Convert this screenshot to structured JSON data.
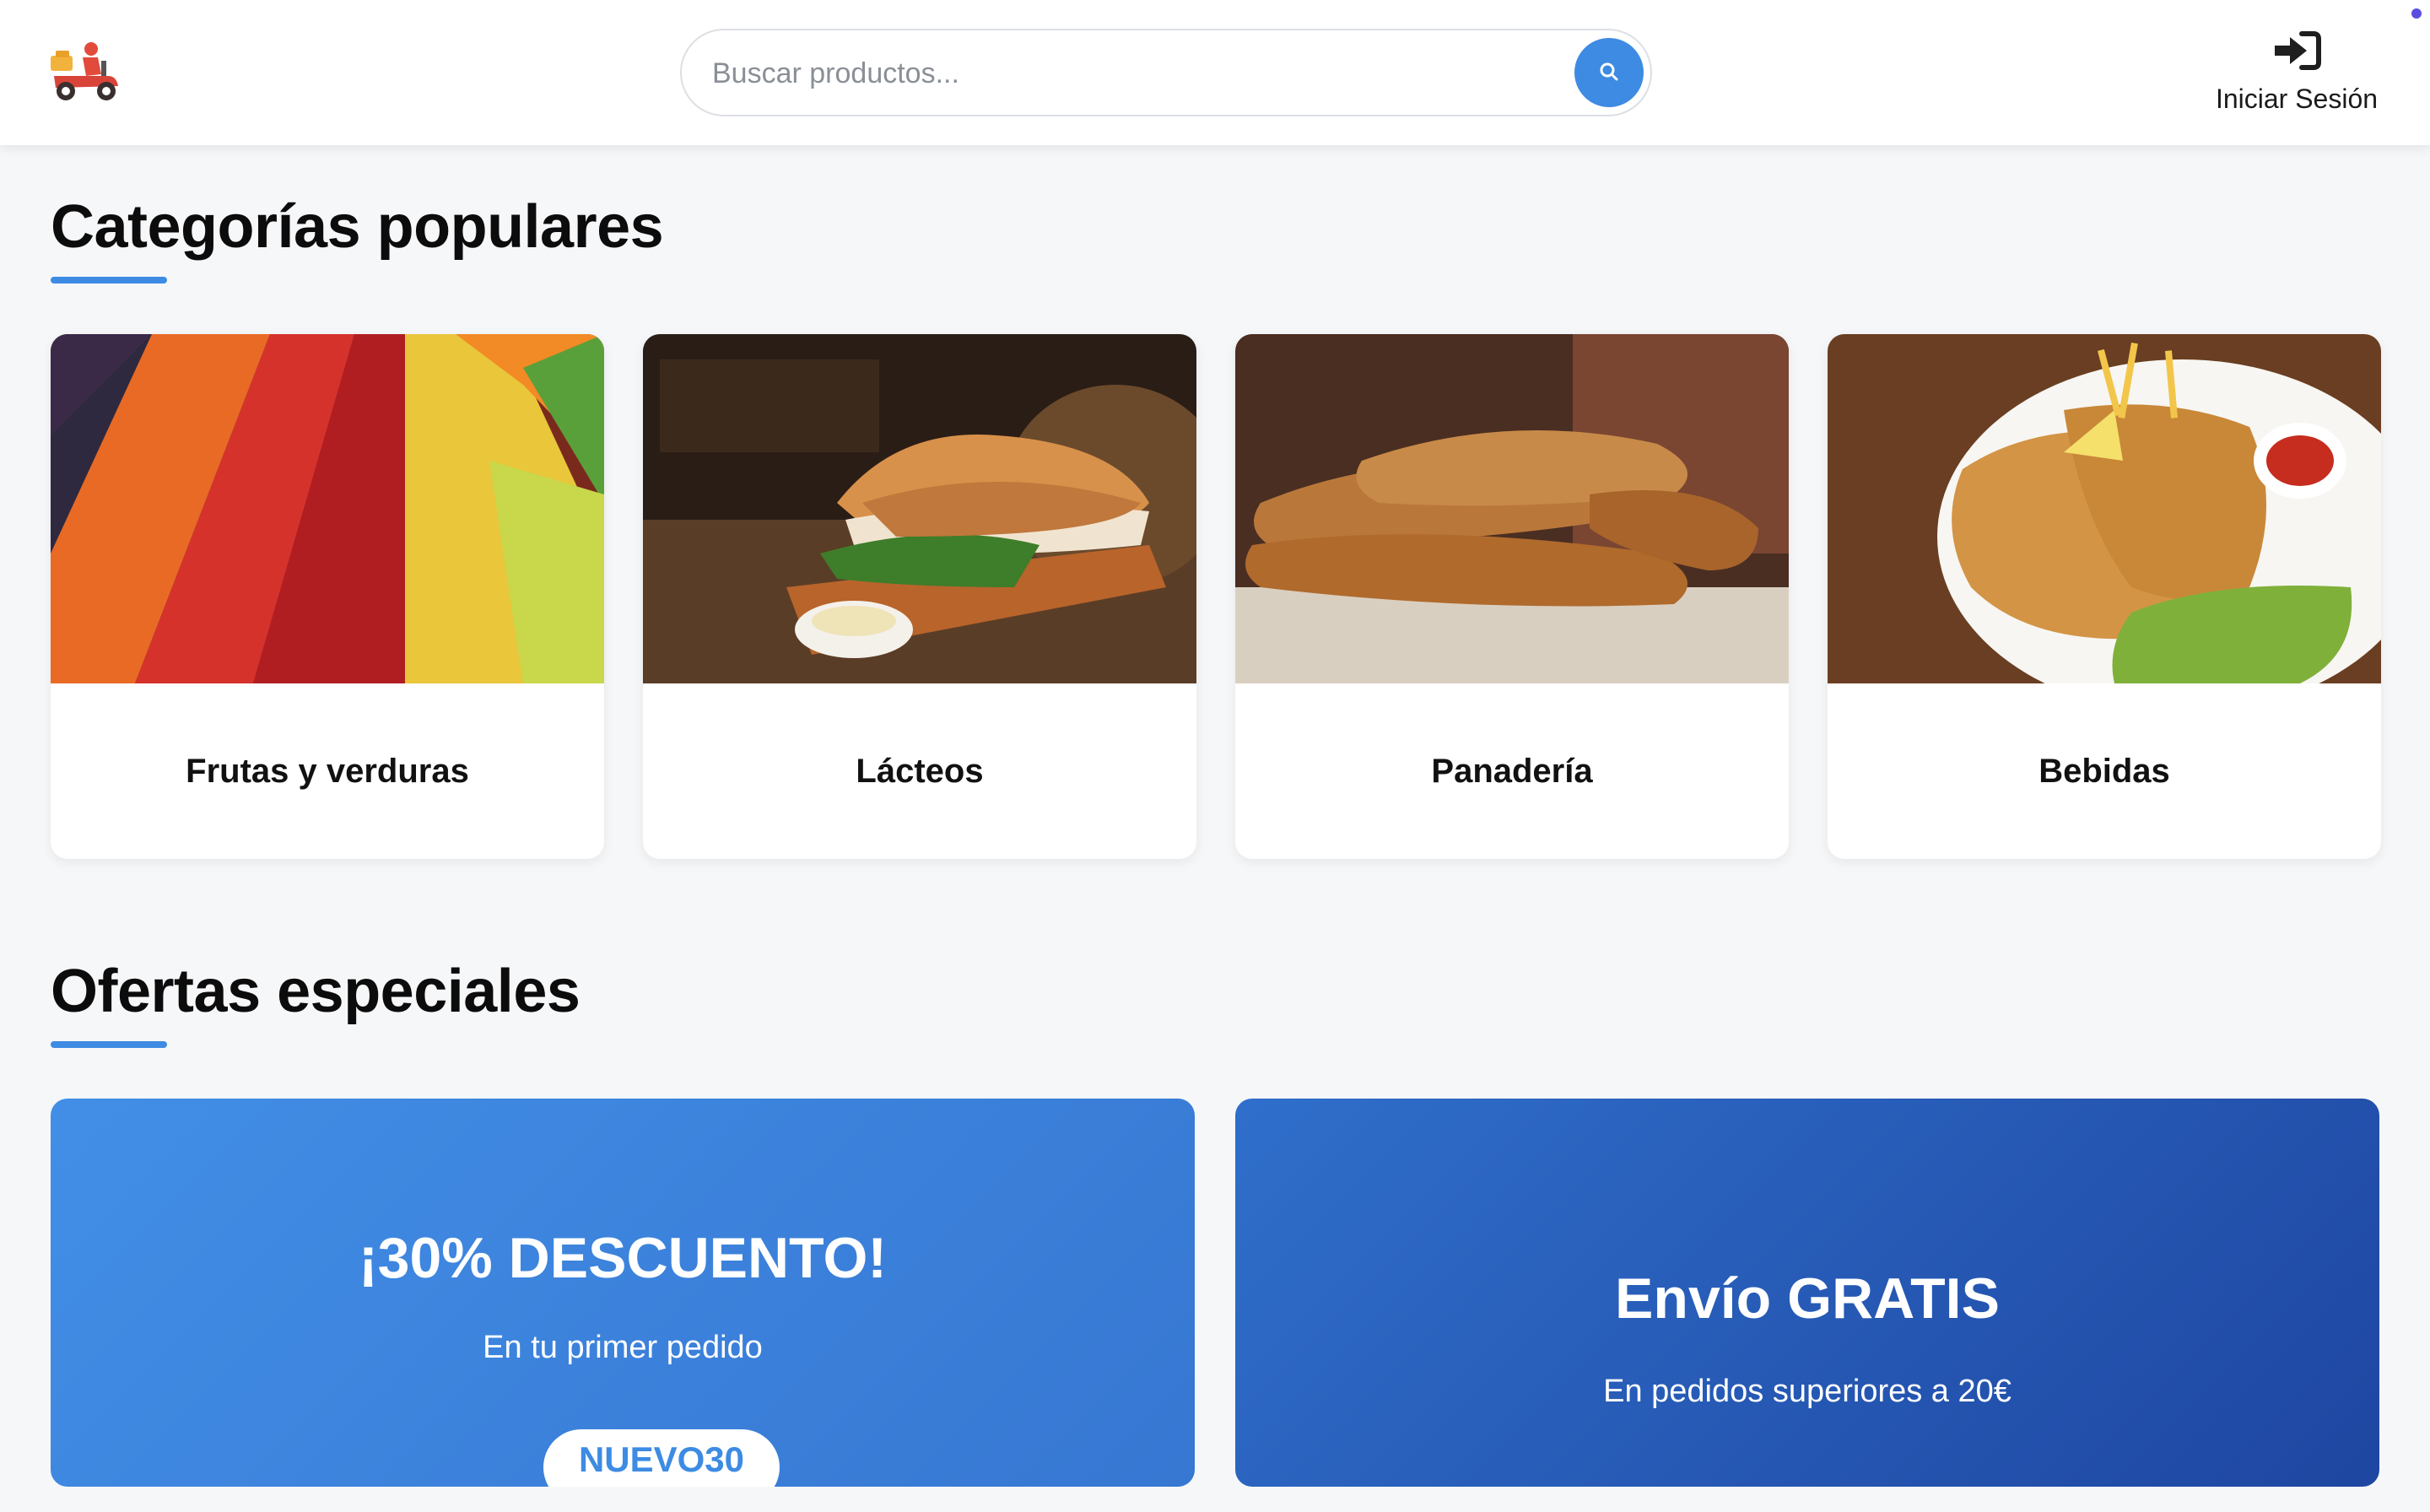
{
  "header": {
    "logo_icon": "delivery-scooter-icon",
    "search": {
      "placeholder": "Buscar productos...",
      "value": "",
      "icon": "search-icon"
    },
    "login": {
      "label": "Iniciar Sesión",
      "icon": "sign-in-icon"
    }
  },
  "categories_section": {
    "title": "Categorías populares",
    "items": [
      {
        "label": "Frutas y verduras",
        "image": "fruits-vegetables-photo"
      },
      {
        "label": "Lácteos",
        "image": "sandwich-photo"
      },
      {
        "label": "Panadería",
        "image": "baguettes-photo"
      },
      {
        "label": "Bebidas",
        "image": "schnitzel-plate-photo"
      }
    ]
  },
  "offers_section": {
    "title": "Ofertas especiales",
    "offers": [
      {
        "title": "¡30% DESCUENTO!",
        "subtitle": "En tu primer pedido",
        "code": "NUEVO30"
      },
      {
        "title": "Envío GRATIS",
        "subtitle": "En pedidos superiores a 20€"
      }
    ]
  },
  "colors": {
    "accent": "#3d8be3",
    "offer_1": "#3a80da",
    "offer_2": "#2755b3",
    "background": "#f6f7f9"
  }
}
